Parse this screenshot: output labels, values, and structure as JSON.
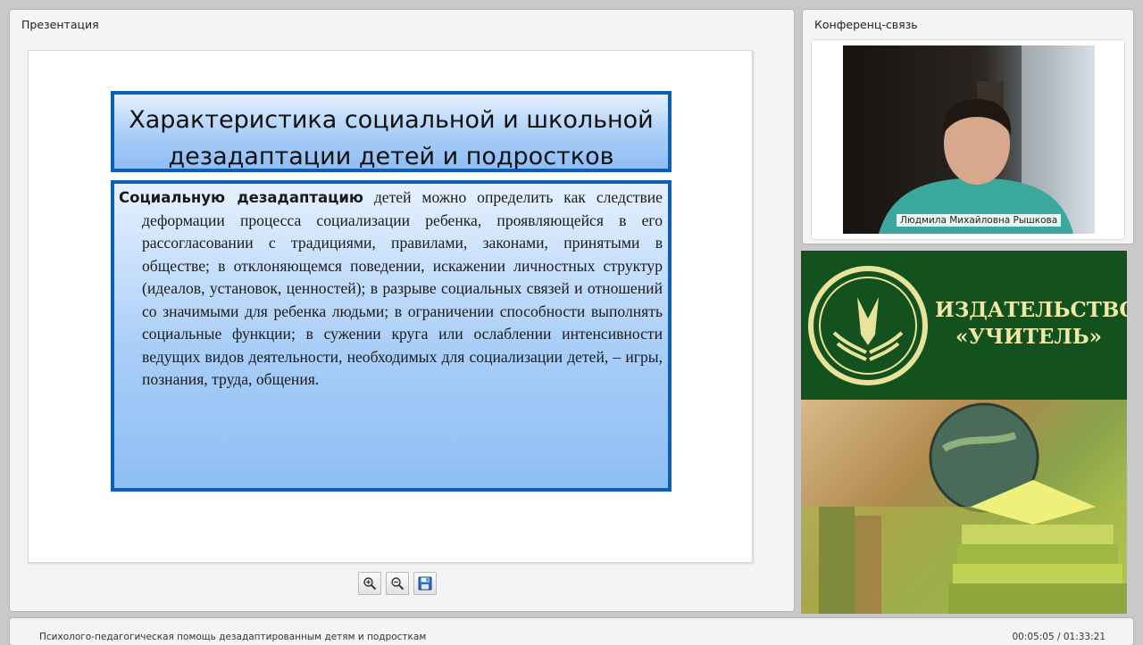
{
  "presentation_panel": {
    "title": "Презентация"
  },
  "slide": {
    "title": "Характеристика социальной и школьной дезадаптации детей и подростков",
    "body_bold": "Социальную дезадаптацию",
    "body_text": " детей можно определить как следствие деформации процесса социализации ребенка, проявляющейся в его рассогласовании с традициями, правилами, законами, принятыми в обществе; в отклоняющемся поведении, искажении личностных структур (идеалов, установок, ценностей); в разрыве социальных связей и отношений со значимыми для ребенка людьми; в ограничении способности выполнять социальные функции; в сужении круга или ослаблении интенсивности ведущих видов деятельности, необходимых для социализации детей, – игры, познания, труда, общения."
  },
  "toolbar": {
    "buttons": [
      {
        "name": "zoom-in-button",
        "icon": "zoom-in-icon"
      },
      {
        "name": "zoom-out-button",
        "icon": "zoom-out-icon"
      },
      {
        "name": "save-button",
        "icon": "floppy-disk-icon"
      }
    ]
  },
  "conference_panel": {
    "title": "Конференц-связь",
    "speaker_name": "Людмила Михайловна Рышкова"
  },
  "ad": {
    "publisher_name": "ИЗДАТЕЛЬСТВО\n«УЧИТЕЛЬ»",
    "colors": {
      "green": "#13521f",
      "gold": "#f0e9a6"
    }
  },
  "status_bar": {
    "course_title": "Психолого-педагогическая помощь дезадаптированным детям и подросткам",
    "timecode": "00:05:05 / 01:33:21"
  },
  "colors": {
    "slide_border": "#0d5fb3",
    "background": "#c9c9c9"
  }
}
